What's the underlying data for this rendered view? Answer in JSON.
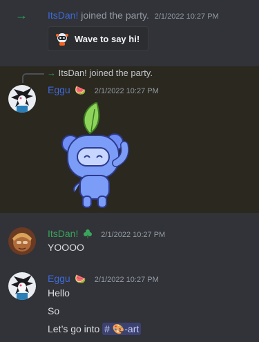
{
  "system": {
    "arrow": "→",
    "user": "ItsDan!",
    "text": " joined the party.",
    "timestamp": "2/1/2022 10:27 PM",
    "wave_label": "Wave to say hi!"
  },
  "reply": {
    "arrow": "→",
    "text": " ItsDan! joined the party."
  },
  "messages": [
    {
      "user": "Eggu",
      "badge_emoji": "🍉",
      "timestamp": "2/1/2022 10:27 PM",
      "content": [
        "sticker: wumpus waving with leaf"
      ]
    },
    {
      "user": "ItsDan!",
      "badge_emoji": "clover",
      "timestamp": "2/1/2022 10:27 PM",
      "lines": [
        "YOOOO"
      ]
    },
    {
      "user": "Eggu",
      "badge_emoji": "🍉",
      "timestamp": "2/1/2022 10:27 PM",
      "lines": [
        "Hello",
        "So",
        "Let’s go into "
      ],
      "channel_mention": {
        "hash": "#",
        "emoji": "🎨",
        "name": "-art"
      }
    }
  ],
  "colors": {
    "background": "#313338",
    "highlight": "#2b2820",
    "username_blue": "#3e6ad8",
    "username_green": "#3ba55c",
    "join_arrow": "#23a55a"
  }
}
